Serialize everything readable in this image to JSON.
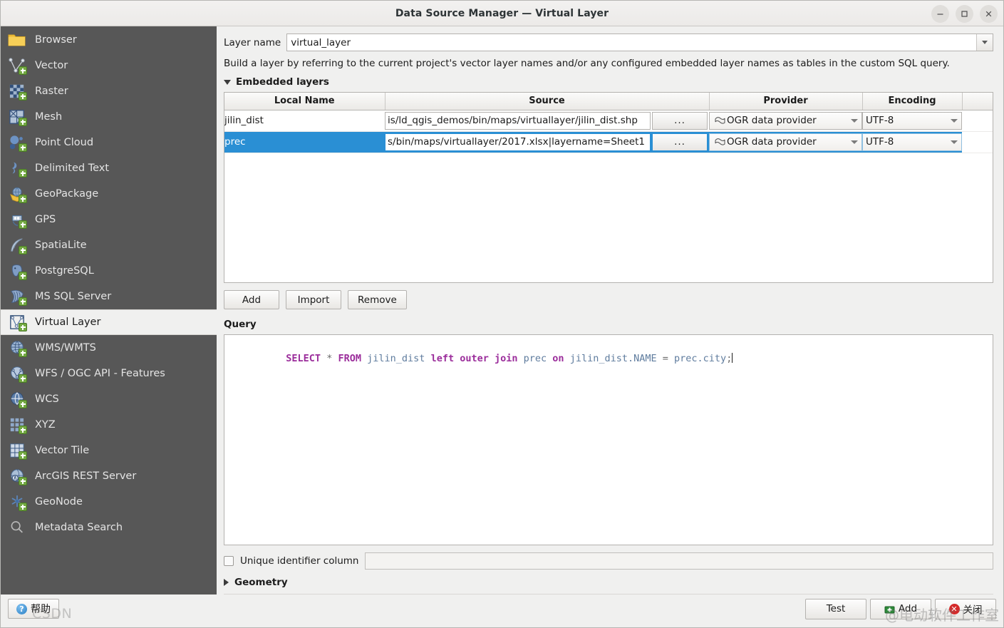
{
  "window": {
    "title": "Data Source Manager — Virtual Layer",
    "controls": [
      {
        "name": "minimize",
        "glyph": "—"
      },
      {
        "name": "maximize",
        "glyph": "□"
      },
      {
        "name": "close",
        "glyph": "✕"
      }
    ]
  },
  "sidebar": {
    "items": [
      {
        "label": "Browser",
        "icon": "folder-icon",
        "selected": false,
        "badge": false
      },
      {
        "label": "Vector",
        "icon": "vector-icon",
        "selected": false,
        "badge": true
      },
      {
        "label": "Raster",
        "icon": "raster-icon",
        "selected": false,
        "badge": true
      },
      {
        "label": "Mesh",
        "icon": "mesh-icon",
        "selected": false,
        "badge": true
      },
      {
        "label": "Point Cloud",
        "icon": "point-cloud-icon",
        "selected": false,
        "badge": true
      },
      {
        "label": "Delimited Text",
        "icon": "delimited-text-icon",
        "selected": false,
        "badge": true
      },
      {
        "label": "GeoPackage",
        "icon": "geopackage-icon",
        "selected": false,
        "badge": true
      },
      {
        "label": "GPS",
        "icon": "gps-icon",
        "selected": false,
        "badge": true
      },
      {
        "label": "SpatiaLite",
        "icon": "spatialite-feather-icon",
        "selected": false,
        "badge": true
      },
      {
        "label": "PostgreSQL",
        "icon": "postgresql-elephant-icon",
        "selected": false,
        "badge": true
      },
      {
        "label": "MS SQL Server",
        "icon": "ms-sql-server-icon",
        "selected": false,
        "badge": true
      },
      {
        "label": "Virtual Layer",
        "icon": "virtual-layer-icon",
        "selected": true,
        "badge": true
      },
      {
        "label": "WMS/WMTS",
        "icon": "wms-wmts-globe-icon",
        "selected": false,
        "badge": true
      },
      {
        "label": "WFS / OGC API - Features",
        "icon": "wfs-globe-icon",
        "selected": false,
        "badge": true
      },
      {
        "label": "WCS",
        "icon": "wcs-globe-icon",
        "selected": false,
        "badge": true
      },
      {
        "label": "XYZ",
        "icon": "xyz-tiles-icon",
        "selected": false,
        "badge": true
      },
      {
        "label": "Vector Tile",
        "icon": "vector-tile-icon",
        "selected": false,
        "badge": true
      },
      {
        "label": "ArcGIS REST Server",
        "icon": "arcgis-rest-globe-icon",
        "selected": false,
        "badge": true
      },
      {
        "label": "GeoNode",
        "icon": "geonode-icon",
        "selected": false,
        "badge": true
      },
      {
        "label": "Metadata Search",
        "icon": "search-icon",
        "selected": false,
        "badge": false
      }
    ]
  },
  "main": {
    "layer_name_label": "Layer name",
    "layer_name_value": "virtual_layer",
    "description": "Build a layer by referring to the current project's vector layer names and/or any configured embedded layer names as tables in the custom SQL query.",
    "embedded_layers_group": "Embedded layers",
    "table": {
      "headers": [
        "Local Name",
        "Source",
        "Provider",
        "Encoding"
      ],
      "rows": [
        {
          "local_name": "jilin_dist",
          "source": "is/ld_qgis_demos/bin/maps/virtuallayer/jilin_dist.shp",
          "browse_label": "...",
          "provider": "OGR data provider",
          "encoding": "UTF-8",
          "selected": false
        },
        {
          "local_name": "prec",
          "source": "s/bin/maps/virtuallayer/2017.xlsx|layername=Sheet1",
          "browse_label": "...",
          "provider": "OGR data provider",
          "encoding": "UTF-8",
          "selected": true
        }
      ]
    },
    "table_buttons": [
      {
        "label": "Add",
        "name": "add-embedded-layer-button"
      },
      {
        "label": "Import",
        "name": "import-embedded-layer-button"
      },
      {
        "label": "Remove",
        "name": "remove-embedded-layer-button"
      }
    ],
    "query_label": "Query",
    "query_tokens": [
      {
        "text": "SELECT",
        "type": "kw"
      },
      {
        "text": " ",
        "type": "pl"
      },
      {
        "text": "*",
        "type": "op"
      },
      {
        "text": " ",
        "type": "pl"
      },
      {
        "text": "FROM",
        "type": "kw"
      },
      {
        "text": " ",
        "type": "pl"
      },
      {
        "text": "jilin_dist",
        "type": "id"
      },
      {
        "text": " ",
        "type": "pl"
      },
      {
        "text": "left outer join",
        "type": "kw"
      },
      {
        "text": " ",
        "type": "pl"
      },
      {
        "text": "prec",
        "type": "id"
      },
      {
        "text": " ",
        "type": "pl"
      },
      {
        "text": "on",
        "type": "kw"
      },
      {
        "text": " ",
        "type": "pl"
      },
      {
        "text": "jilin_dist.NAME",
        "type": "id"
      },
      {
        "text": " ",
        "type": "pl"
      },
      {
        "text": "=",
        "type": "op"
      },
      {
        "text": " ",
        "type": "pl"
      },
      {
        "text": "prec.city",
        "type": "id"
      },
      {
        "text": ";",
        "type": "op"
      }
    ],
    "query_plain": "SELECT * FROM jilin_dist left outer join prec on jilin_dist.NAME = prec.city;",
    "unique_id_label": "Unique identifier column",
    "unique_id_value": "",
    "unique_id_checked": false,
    "geometry_group": "Geometry"
  },
  "footer": {
    "help_label": "帮助",
    "test_label": "Test",
    "add_label": "Add",
    "close_label": "关闭"
  },
  "watermark": {
    "csdn": "CSDN",
    "handle": "@电动软件工作室"
  },
  "colors": {
    "sidebar_bg": "#575757",
    "panel_bg": "#f0f0ef",
    "selection_blue": "#2a8fd4",
    "sql_keyword": "#9b2d9b",
    "sql_identifier": "#5f7c9e",
    "badge_green": "#73a942",
    "close_red": "#d42a2a"
  }
}
